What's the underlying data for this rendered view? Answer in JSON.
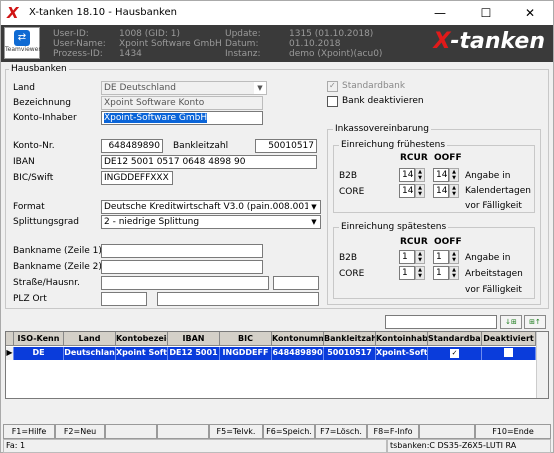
{
  "window": {
    "title": "X-tanken 18.10 - Hausbanken",
    "logo_letter": "X",
    "min": "—",
    "max": "☐",
    "close": "✕"
  },
  "header": {
    "teamviewer": "Teamviewer",
    "user_id_label": "User-ID:",
    "user_id": "1008 (GID: 1)",
    "user_name_label": "User-Name:",
    "user_name": "Xpoint Software GmbH",
    "prozess_label": "Prozess-ID:",
    "prozess_id": "1434",
    "update_label": "Update:",
    "update": "1315 (01.10.2018)",
    "datum_label": "Datum:",
    "datum": "01.10.2018",
    "instanz_label": "Instanz:",
    "instanz": "demo (Xpoint)(acu0)",
    "brand_x": "X",
    "brand_rest": "-tanken"
  },
  "form": {
    "group_title": "Hausbanken",
    "land_label": "Land",
    "land_value": "DE Deutschland",
    "bezeichnung_label": "Bezeichnung",
    "bezeichnung_value": "Xpoint Software Konto",
    "konto_inhaber_label": "Konto-Inhaber",
    "konto_inhaber_value": "Xpoint-Software GmbH",
    "standardbank_label": "Standardbank",
    "bank_deaktivieren_label": "Bank deaktivieren",
    "konto_nr_label": "Konto-Nr.",
    "konto_nr_value": "648489890",
    "blz_label": "Bankleitzahl",
    "blz_value": "50010517",
    "iban_label": "IBAN",
    "iban_value": "DE12 5001 0517 0648 4898 90",
    "bic_label": "BIC/Swift",
    "bic_value": "INGDDEFFXXX",
    "format_label": "Format",
    "format_value": "Deutsche Kreditwirtschaft V3.0 (pain.008.001.0",
    "splittung_label": "Splittungsgrad",
    "splittung_value": "2 - niedrige Splittung",
    "bankname1_label": "Bankname (Zeile 1)",
    "bankname2_label": "Bankname (Zeile 2)",
    "strasse_label": "Straße/Hausnr.",
    "plz_label": "PLZ Ort"
  },
  "inkasso": {
    "title": "Inkassovereinbarung",
    "frueh": {
      "title": "Einreichung frühestens",
      "rcur": "RCUR",
      "ooff": "OOFF",
      "b2b_label": "B2B",
      "b2b_rcur": "14",
      "b2b_ooff": "14",
      "core_label": "CORE",
      "core_rcur": "14",
      "core_ooff": "14",
      "note1": "Angabe in",
      "note2": "Kalendertagen",
      "note3": "vor Fälligkeit"
    },
    "spaet": {
      "title": "Einreichung spätestens",
      "rcur": "RCUR",
      "ooff": "OOFF",
      "b2b_label": "B2B",
      "b2b_rcur": "1",
      "b2b_ooff": "1",
      "core_label": "CORE",
      "core_rcur": "1",
      "core_ooff": "1",
      "note1": "Angabe in",
      "note2": "Arbeitstagen",
      "note3": "vor Fälligkeit"
    }
  },
  "toolbar": {
    "btn1": "↓⊞",
    "btn2": "⊞↑"
  },
  "grid": {
    "headers": [
      "ISO-Kenn",
      "Land",
      "Kontobezeic",
      "IBAN",
      "BIC",
      "Kontonumm",
      "Bankleitzah",
      "Kontoinhabe",
      "Standardbar",
      "Deaktiviert"
    ],
    "row": [
      "DE",
      "Deutschlan",
      "Xpoint Soft",
      "DE12 5001",
      "INGDDEFF",
      "648489890",
      "50010517",
      "Xpoint-Soft",
      "",
      ""
    ]
  },
  "fkeys": [
    "F1=Hilfe",
    "F2=Neu",
    "",
    "",
    "F5=Telvk.",
    "F6=Speich.",
    "F7=Lösch.",
    "F8=F-Info",
    "",
    "F10=Ende"
  ],
  "status": {
    "left": "Fa: 1",
    "right": "tsbanken:C DS35-Z6X5-LUTI RA"
  }
}
